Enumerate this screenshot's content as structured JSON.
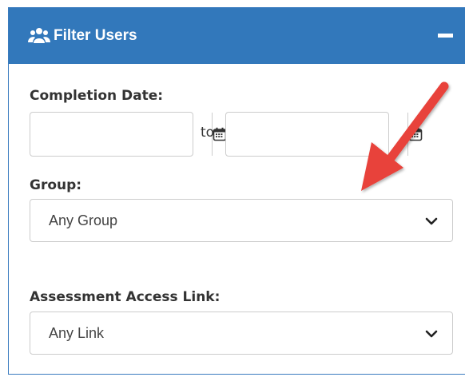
{
  "panel": {
    "title": "Filter Users",
    "header_color": "#3278bb",
    "icon": "users-icon",
    "collapse_icon": "minus-icon"
  },
  "completion_date": {
    "label": "Completion Date:",
    "from_value": "",
    "to_value": "",
    "separator": "to",
    "icon": "calendar-icon"
  },
  "group": {
    "label": "Group:",
    "selected": "Any Group"
  },
  "assessment_link": {
    "label": "Assessment Access Link:",
    "selected": "Any Link"
  },
  "annotation": {
    "arrow_color": "#e8433a"
  }
}
